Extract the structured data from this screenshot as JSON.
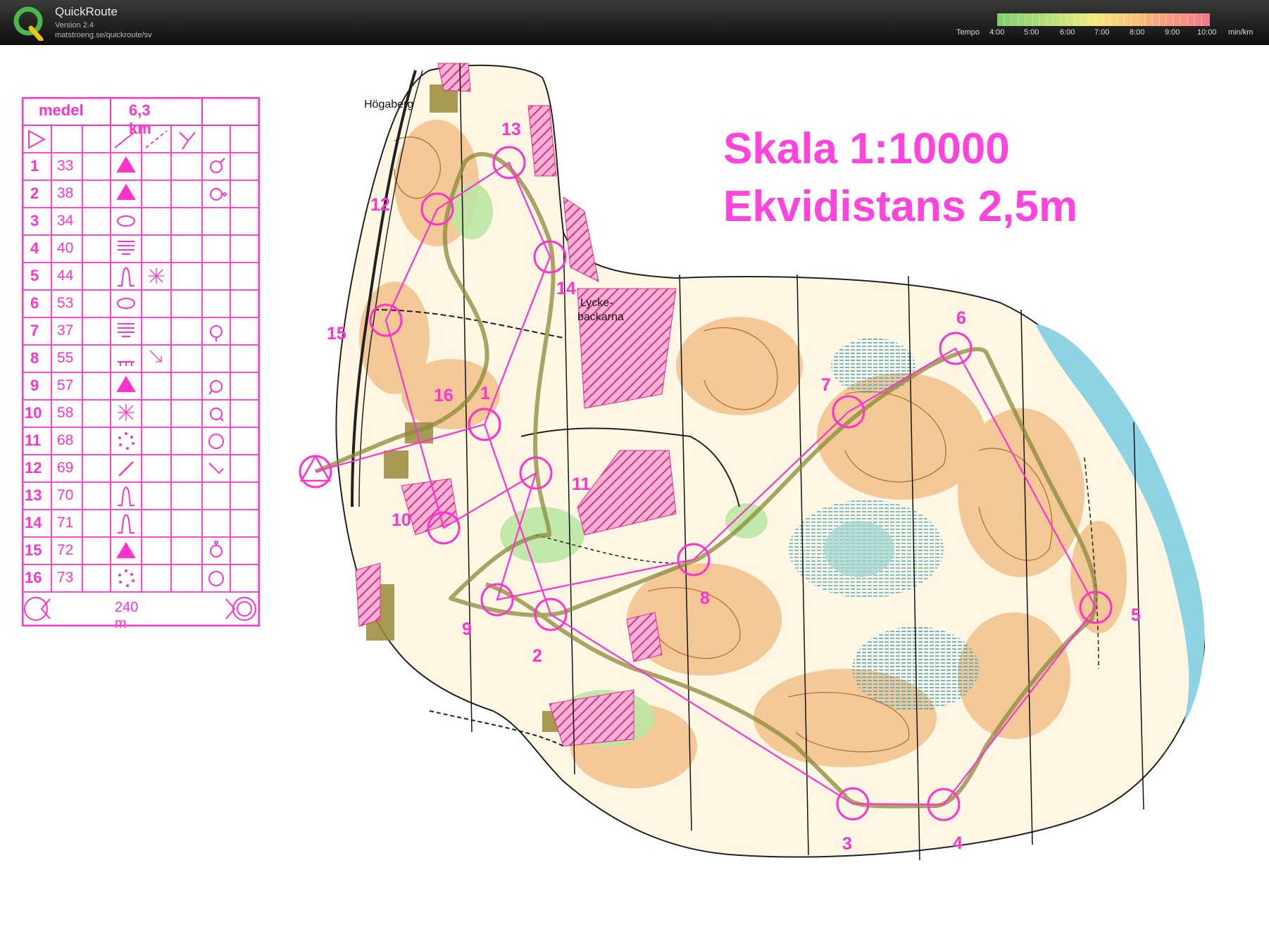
{
  "app": {
    "name": "QuickRoute",
    "version": "Version 2.4",
    "url": "matstroeng.se/quickroute/sv"
  },
  "pace_legend": {
    "label": "Tempo",
    "ticks": [
      "4:00",
      "5:00",
      "6:00",
      "7:00",
      "8:00",
      "9:00",
      "10:00"
    ],
    "unit": "min/km",
    "colors": [
      "#7fce6e",
      "#f2ea7c",
      "#f07a8a"
    ]
  },
  "map": {
    "scale_text": "Skala 1:10000",
    "contour_text": "Ekvidistans 2,5m",
    "place_labels": [
      "Högaberg",
      "Lycke-",
      "backarna"
    ],
    "course_color": "#ff33cc",
    "route_color": "#8a8a3a"
  },
  "control_card": {
    "class_name": "medel",
    "length": "6,3 km",
    "controls": [
      {
        "num": "1",
        "code": "33"
      },
      {
        "num": "2",
        "code": "38"
      },
      {
        "num": "3",
        "code": "34"
      },
      {
        "num": "4",
        "code": "40"
      },
      {
        "num": "5",
        "code": "44"
      },
      {
        "num": "6",
        "code": "53"
      },
      {
        "num": "7",
        "code": "37"
      },
      {
        "num": "8",
        "code": "55"
      },
      {
        "num": "9",
        "code": "57"
      },
      {
        "num": "10",
        "code": "58"
      },
      {
        "num": "11",
        "code": "68"
      },
      {
        "num": "12",
        "code": "69"
      },
      {
        "num": "13",
        "code": "70"
      },
      {
        "num": "14",
        "code": "71"
      },
      {
        "num": "15",
        "code": "72"
      },
      {
        "num": "16",
        "code": "73"
      }
    ],
    "finish_distance": "240 m"
  },
  "course_labels": [
    "1",
    "2",
    "3",
    "4",
    "5",
    "6",
    "7",
    "8",
    "9",
    "10",
    "11",
    "12",
    "13",
    "14",
    "15",
    "16"
  ]
}
